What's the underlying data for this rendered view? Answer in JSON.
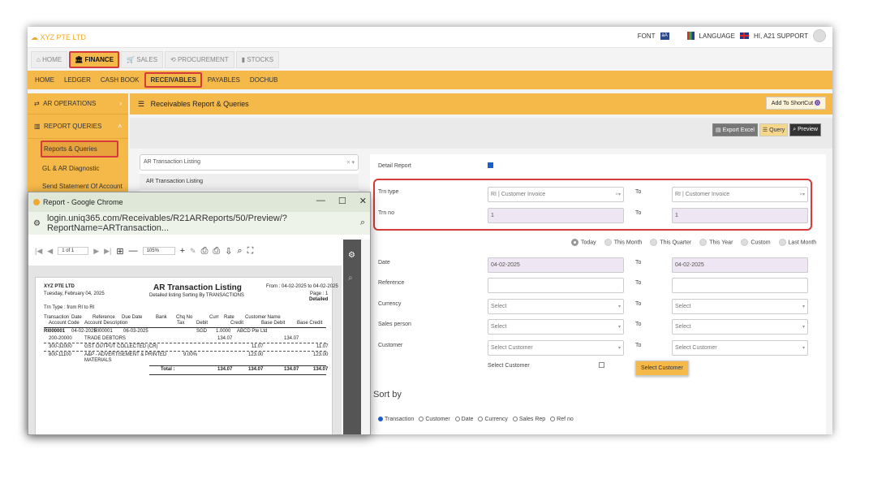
{
  "app": {
    "logo": "XYZ PTE LTD",
    "font_label": "FONT",
    "language_label": "LANGUAGE",
    "user_greeting": "HI, A21 SUPPORT",
    "font_icon_text": "aA"
  },
  "module_tabs": [
    {
      "label": "HOME",
      "icon": "⌂"
    },
    {
      "label": "FINANCE",
      "icon": "🏛"
    },
    {
      "label": "SALES",
      "icon": "🛒"
    },
    {
      "label": "PROCUREMENT",
      "icon": "⟲"
    },
    {
      "label": "STOCKS",
      "icon": "▮"
    }
  ],
  "sub_tabs": [
    "HOME",
    "LEDGER",
    "CASH BOOK",
    "RECEIVABLES",
    "PAYABLES",
    "DOCHUB"
  ],
  "sidebar": {
    "ar_operations": "AR OPERATIONS",
    "report_queries": "REPORT QUERIES",
    "items": [
      "Reports & Queries",
      "GL & AR Diagnostic",
      "Send Statement Of Account"
    ]
  },
  "header": {
    "title": "Receivables Report & Queries",
    "shortcut": "Add To ShortCut",
    "export_excel": "Export Excel",
    "query": "Query",
    "preview": "Preview"
  },
  "report_list": {
    "selected": "AR Transaction Listing",
    "option": "AR Transaction Listing"
  },
  "form": {
    "detail_report": "Detail Report",
    "trn_type_label": "Trn type",
    "trn_type_from": "RI | Customer Invoice",
    "trn_type_to": "RI | Customer Invoice",
    "trn_no_label": "Trn no",
    "trn_no_from": "1",
    "trn_no_to": "1",
    "to": "To",
    "periods": [
      "Today",
      "This Month",
      "This Quarter",
      "This Year",
      "Custom",
      "Last Month"
    ],
    "date_label": "Date",
    "date_from": "04-02-2025",
    "date_to": "04-02-2025",
    "reference_label": "Reference",
    "currency_label": "Currency",
    "sales_person_label": "Sales person",
    "customer_label": "Customer",
    "select_placeholder": "Select",
    "select_customer_placeholder": "Select Customer",
    "select_customer_check": "Select Customer",
    "select_customer_button": "Select Customer",
    "sort_by": "Sort by",
    "sort_options": [
      "Transaction",
      "Customer",
      "Date",
      "Currency",
      "Sales Rep",
      "Ref no"
    ]
  },
  "popup": {
    "title": "Report - Google Chrome",
    "url": "login.uniq365.com/Receivables/R21ARReports/50/Preview/?ReportName=ARTransaction...",
    "page_sel": "1 of 1",
    "zoom_sel": "105%"
  },
  "report": {
    "company": "XYZ PTE LTD",
    "date_line": "Tuesday, February 04, 2025",
    "title": "AR Transaction Listing",
    "subtitle": "Detailed listing Sorting By TRANSACTIONS",
    "from_to": "From : 04-02-2025 to 04-02-2025",
    "page": "Page : 1",
    "detailed": "Detailed",
    "trn_type": "Trn Type : from RI to RI",
    "headers1": [
      "Transaction",
      "Date",
      "Reference",
      "Due Date",
      "Bank",
      "Chq No",
      "Curr",
      "Rate",
      "Customer Name"
    ],
    "headers2": [
      "Account Code",
      "Account Description",
      "Tax",
      "Debit",
      "Credit",
      "Base Debit",
      "Base Credit"
    ],
    "row1": [
      "RI000001",
      "04-02-2025",
      "RI00001",
      "06-03-2025",
      "SGD",
      "1.0000",
      "ABCD Pte Ltd"
    ],
    "line1": [
      "200-20000",
      "TRADE DEBTORS",
      "134.07",
      "134.07"
    ],
    "line2": [
      "300-32000",
      "GST OUTPUT COLLECTED (CR)",
      "11.07",
      "11.07"
    ],
    "line3": [
      "800-11100",
      "A&P - ADVERTISEMENT & PRINTED",
      "MATERIALS",
      "9.00%",
      "123.00",
      "123.00"
    ],
    "total_label": "Total :",
    "totals": [
      "134.07",
      "134.07",
      "134.07",
      "134.07"
    ]
  },
  "colors": {
    "accent": "#f5b94a",
    "highlight_border": "#d63a3a",
    "lavender_field": "#eee6f2"
  }
}
